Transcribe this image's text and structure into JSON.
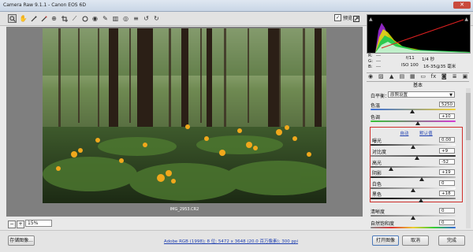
{
  "window": {
    "title": "Camera Raw 9.1.1 - Canon EOS 6D",
    "close_label": "✕"
  },
  "toolbar": {
    "preview_label": "预览",
    "preview_checked": "✓",
    "tools": [
      "zoom-icon",
      "hand-icon",
      "white-balance-icon",
      "color-sampler-icon",
      "targeted-adjust-icon",
      "crop-icon",
      "straighten-icon",
      "spot-removal-icon",
      "red-eye-icon",
      "adjustment-brush-icon",
      "graduated-filter-icon",
      "radial-filter-icon",
      "preferences-icon",
      "rotate-ccw-icon",
      "rotate-cw-icon"
    ]
  },
  "image": {
    "filename": "IMG_2953.CR2"
  },
  "zoom": {
    "minus": "−",
    "plus": "+",
    "value": "15%"
  },
  "info": {
    "rgb": [
      "R:",
      "G:",
      "B:"
    ],
    "rgb_vals": [
      "---",
      "---",
      "---"
    ],
    "exposure": [
      "f/11",
      "1/4 秒"
    ],
    "iso": [
      "ISO 100",
      "16-35@35 毫米"
    ]
  },
  "panel": {
    "title": "基本",
    "white_balance_label": "白平衡：",
    "white_balance_value": "原照设置",
    "temp_label": "色温",
    "temp_value": "5250",
    "tint_label": "色调",
    "tint_value": "+10",
    "auto_label": "自动",
    "default_label": "默认值",
    "adjustments": [
      {
        "label": "曝光",
        "value": "0.00"
      },
      {
        "label": "对比度",
        "value": "+9"
      },
      {
        "label": "高光",
        "value": "-52"
      },
      {
        "label": "阴影",
        "value": "+19"
      },
      {
        "label": "白色",
        "value": "0"
      },
      {
        "label": "黑色",
        "value": "+18"
      }
    ],
    "clarity_label": "清晰度",
    "clarity_value": "0",
    "vibrance_label": "自然饱和度",
    "vibrance_value": "0"
  },
  "bottom": {
    "save_label": "存储图像...",
    "workflow_text": "Adobe RGB (1998); 8 位; 5472 x 3648 (20.0 百万像素); 300 ppi",
    "open_label": "打开图像",
    "cancel_label": "取消",
    "done_label": "完成"
  },
  "colors": {
    "accent_red": "#d0302c",
    "link_blue": "#2040b0"
  }
}
